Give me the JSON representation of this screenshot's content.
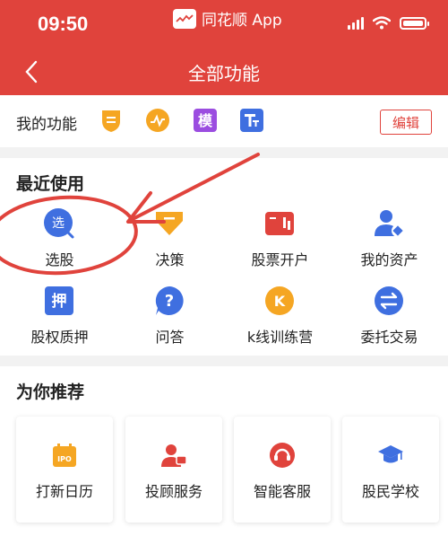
{
  "status_bar": {
    "time": "09:50",
    "app_name": "同花顺 App"
  },
  "header": {
    "title": "全部功能"
  },
  "my_functions": {
    "label": "我的功能",
    "icons": [
      "strategy-icon",
      "trend-icon",
      "template-icon",
      "text-size-icon"
    ],
    "template_char": "模",
    "edit_label": "编辑"
  },
  "recent": {
    "title": "最近使用",
    "items": [
      {
        "label": "选股",
        "icon": "stock-picker-icon",
        "glyph": "选"
      },
      {
        "label": "决策",
        "icon": "decision-icon"
      },
      {
        "label": "股票开户",
        "icon": "account-opening-icon"
      },
      {
        "label": "我的资产",
        "icon": "my-assets-icon"
      },
      {
        "label": "股权质押",
        "icon": "pledge-icon",
        "glyph": "押"
      },
      {
        "label": "问答",
        "icon": "question-icon",
        "glyph": "?"
      },
      {
        "label": "k线训练营",
        "icon": "kline-training-icon",
        "glyph": "K"
      },
      {
        "label": "委托交易",
        "icon": "trade-icon"
      }
    ]
  },
  "recommend": {
    "title": "为你推荐",
    "cards": [
      {
        "label": "打新日历",
        "icon": "ipo-calendar-icon",
        "glyph": "IPO"
      },
      {
        "label": "投顾服务",
        "icon": "advisor-icon"
      },
      {
        "label": "智能客服",
        "icon": "customer-service-icon"
      },
      {
        "label": "股民学校",
        "icon": "school-icon"
      }
    ]
  },
  "colors": {
    "brand": "#e0433c",
    "blue": "#3f6fe0",
    "orange": "#f5a623"
  }
}
